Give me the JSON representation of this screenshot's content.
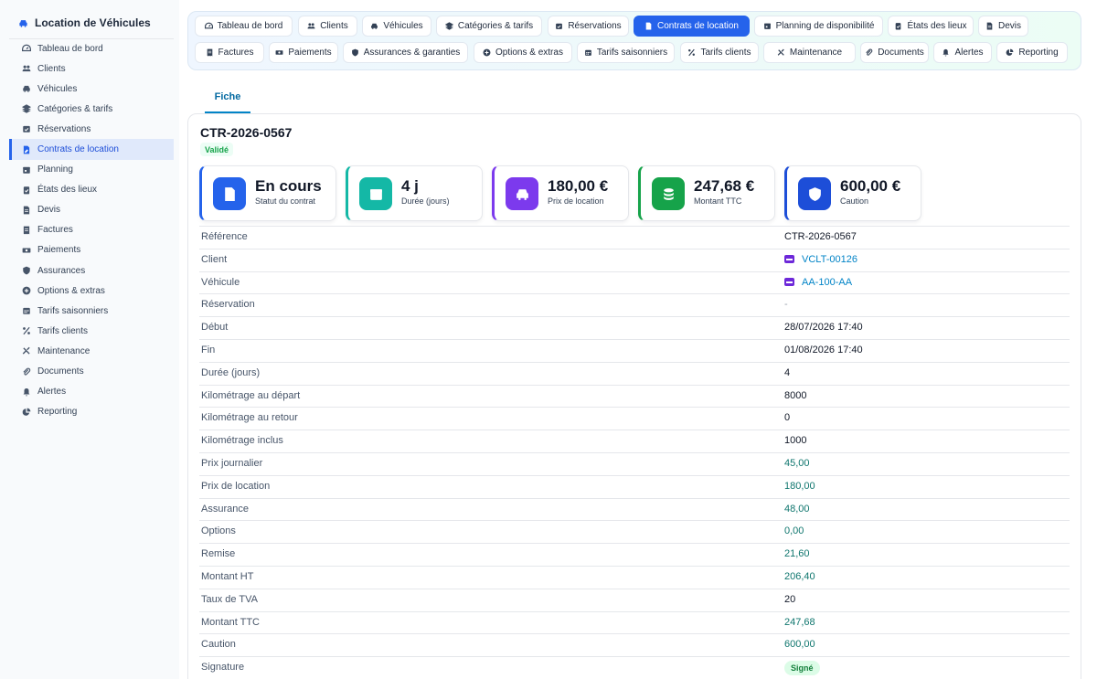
{
  "app": {
    "title": "Location de Véhicules",
    "icon": "car-icon"
  },
  "sidebar": {
    "items": [
      {
        "label": "Tableau de bord",
        "icon": "dashboard-icon",
        "active": false
      },
      {
        "label": "Clients",
        "icon": "users-icon",
        "active": false
      },
      {
        "label": "Véhicules",
        "icon": "car-icon",
        "active": false
      },
      {
        "label": "Catégories & tarifs",
        "icon": "layers-icon",
        "active": false
      },
      {
        "label": "Réservations",
        "icon": "calendar-check-icon",
        "active": false
      },
      {
        "label": "Contrats de location",
        "icon": "file-signature-icon",
        "active": true
      },
      {
        "label": "Planning",
        "icon": "calendar-icon",
        "active": false
      },
      {
        "label": "États des lieux",
        "icon": "clipboard-check-icon",
        "active": false
      },
      {
        "label": "Devis",
        "icon": "file-icon",
        "active": false
      },
      {
        "label": "Factures",
        "icon": "invoice-icon",
        "active": false
      },
      {
        "label": "Paiements",
        "icon": "money-icon",
        "active": false
      },
      {
        "label": "Assurances",
        "icon": "shield-icon",
        "active": false
      },
      {
        "label": "Options & extras",
        "icon": "plus-circle-icon",
        "active": false
      },
      {
        "label": "Tarifs saisonniers",
        "icon": "calendar-days-icon",
        "active": false
      },
      {
        "label": "Tarifs clients",
        "icon": "percent-icon",
        "active": false
      },
      {
        "label": "Maintenance",
        "icon": "tools-icon",
        "active": false
      },
      {
        "label": "Documents",
        "icon": "paperclip-icon",
        "active": false
      },
      {
        "label": "Alertes",
        "icon": "bell-icon",
        "active": false
      },
      {
        "label": "Reporting",
        "icon": "pie-chart-icon",
        "active": false
      }
    ]
  },
  "tabs": [
    {
      "label": "Tableau de bord",
      "icon": "dashboard-icon",
      "active": false
    },
    {
      "label": "Clients",
      "icon": "users-icon",
      "active": false
    },
    {
      "label": "Véhicules",
      "icon": "car-icon",
      "active": false
    },
    {
      "label": "Catégories & tarifs",
      "icon": "layers-icon",
      "active": false
    },
    {
      "label": "Réservations",
      "icon": "calendar-check-icon",
      "active": false
    },
    {
      "label": "Contrats de location",
      "icon": "file-signature-icon",
      "active": true
    },
    {
      "label": "Planning de disponibilité",
      "icon": "calendar-icon",
      "active": false
    },
    {
      "label": "États des lieux",
      "icon": "clipboard-check-icon",
      "active": false
    },
    {
      "label": "Devis",
      "icon": "file-icon",
      "active": false
    },
    {
      "label": "Factures",
      "icon": "invoice-icon",
      "active": false
    },
    {
      "label": "Paiements",
      "icon": "money-icon",
      "active": false
    },
    {
      "label": "Assurances & garanties",
      "icon": "shield-icon",
      "active": false
    },
    {
      "label": "Options & extras",
      "icon": "plus-circle-icon",
      "active": false
    },
    {
      "label": "Tarifs saisonniers",
      "icon": "calendar-days-icon",
      "active": false
    },
    {
      "label": "Tarifs clients",
      "icon": "percent-icon",
      "active": false
    },
    {
      "label": "Maintenance",
      "icon": "tools-icon",
      "active": false
    },
    {
      "label": "Documents",
      "icon": "paperclip-icon",
      "active": false
    },
    {
      "label": "Alertes",
      "icon": "bell-icon",
      "active": false
    },
    {
      "label": "Reporting",
      "icon": "pie-chart-icon",
      "active": false
    }
  ],
  "subtab": {
    "label": "Fiche"
  },
  "record": {
    "title": "CTR-2026-0567",
    "status_badge": "Validé"
  },
  "stats": [
    {
      "value": "En cours",
      "label": "Statut du contrat",
      "icon": "file-signature-icon",
      "color": "#2563eb"
    },
    {
      "value": "4 j",
      "label": "Durée (jours)",
      "icon": "calendar-icon",
      "color": "#14b8a6"
    },
    {
      "value": "180,00 €",
      "label": "Prix de location",
      "icon": "car-icon",
      "color": "#7c3aed"
    },
    {
      "value": "247,68 €",
      "label": "Montant TTC",
      "icon": "coins-icon",
      "color": "#16a34a"
    },
    {
      "value": "600,00 €",
      "label": "Caution",
      "icon": "shield-icon",
      "color": "#1d4ed8"
    }
  ],
  "details": [
    {
      "label": "Référence",
      "value": "CTR-2026-0567",
      "kind": "text"
    },
    {
      "label": "Client",
      "value": "VCLT-00126",
      "kind": "link"
    },
    {
      "label": "Véhicule",
      "value": "AA-100-AA",
      "kind": "link"
    },
    {
      "label": "Réservation",
      "value": "-",
      "kind": "muted"
    },
    {
      "label": "Début",
      "value": "28/07/2026 17:40",
      "kind": "text"
    },
    {
      "label": "Fin",
      "value": "01/08/2026 17:40",
      "kind": "text"
    },
    {
      "label": "Durée (jours)",
      "value": "4",
      "kind": "text"
    },
    {
      "label": "Kilométrage au départ",
      "value": "8000",
      "kind": "text"
    },
    {
      "label": "Kilométrage au retour",
      "value": "0",
      "kind": "text"
    },
    {
      "label": "Kilométrage inclus",
      "value": "1000",
      "kind": "text"
    },
    {
      "label": "Prix journalier",
      "value": "45,00",
      "kind": "money"
    },
    {
      "label": "Prix de location",
      "value": "180,00",
      "kind": "money"
    },
    {
      "label": "Assurance",
      "value": "48,00",
      "kind": "money"
    },
    {
      "label": "Options",
      "value": "0,00",
      "kind": "money"
    },
    {
      "label": "Remise",
      "value": "21,60",
      "kind": "money"
    },
    {
      "label": "Montant HT",
      "value": "206,40",
      "kind": "money"
    },
    {
      "label": "Taux de TVA",
      "value": "20",
      "kind": "text"
    },
    {
      "label": "Montant TTC",
      "value": "247,68",
      "kind": "money"
    },
    {
      "label": "Caution",
      "value": "600,00",
      "kind": "money"
    },
    {
      "label": "Signature",
      "value": "Signé",
      "kind": "pill"
    }
  ]
}
